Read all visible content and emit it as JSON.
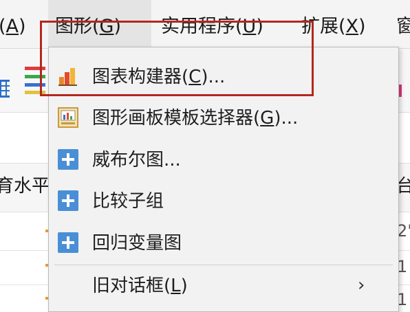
{
  "menubar": {
    "items": [
      {
        "label_pre": "",
        "label_key": "A",
        "label_open": "(",
        "label_close": ")",
        "text": "(A)"
      },
      {
        "text": "图形(G)"
      },
      {
        "text": "实用程序(U)"
      },
      {
        "text": "扩展(X)"
      },
      {
        "text": "窗"
      }
    ],
    "item0": {
      "prefix": "(",
      "key": "A",
      "suffix": ")"
    },
    "item1": {
      "prefix": "图形(",
      "key": "G",
      "suffix": ")"
    },
    "item2": {
      "prefix": "实用程序(",
      "key": "U",
      "suffix": ")"
    },
    "item3": {
      "prefix": "扩展(",
      "key": "X",
      "suffix": ")"
    },
    "item4": {
      "prefix": "窗",
      "key": "",
      "suffix": ""
    }
  },
  "grid": {
    "header_text": "育水平",
    "header_right": "台",
    "right_cells": [
      "2'",
      "1",
      "1"
    ]
  },
  "dropdown": {
    "chart_builder": {
      "prefix": "图表构建器(",
      "key": "C",
      "suffix": ")..."
    },
    "graphboard": {
      "prefix": "图形画板模板选择器(",
      "key": "G",
      "suffix": ")..."
    },
    "weibull": {
      "text": "威布尔图..."
    },
    "compare_subgroups": {
      "text": "比较子组"
    },
    "regression_variable": {
      "text": "回归变量图"
    },
    "legacy": {
      "prefix": "旧对话框(",
      "key": "L",
      "suffix": ")",
      "arrow": "›"
    }
  },
  "colors": {
    "highlight": "#b3271f",
    "plus_icon": "#4a8fd6",
    "menu_bg": "#f2f2f2"
  },
  "icons": {
    "chart_builder": "bar-chart-icon",
    "graphboard": "graphboard-icon",
    "plus": "plus-icon"
  }
}
